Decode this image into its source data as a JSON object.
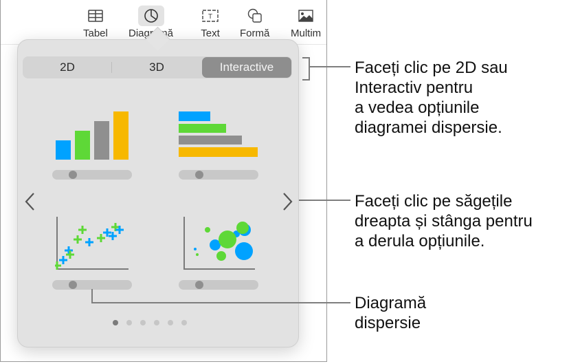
{
  "toolbar": {
    "items": [
      {
        "label": "Tabel",
        "icon": "table-icon"
      },
      {
        "label": "Diagramă",
        "icon": "chart-icon",
        "active": true
      },
      {
        "label": "Text",
        "icon": "text-box-icon"
      },
      {
        "label": "Formă",
        "icon": "shape-icon"
      },
      {
        "label": "Multim",
        "icon": "media-icon"
      }
    ]
  },
  "chart_picker": {
    "tabs": [
      {
        "label": "2D"
      },
      {
        "label": "3D"
      },
      {
        "label": "Interactive",
        "selected": true
      }
    ],
    "thumbnails": [
      {
        "name": "column-chart",
        "slider_position": 0.2
      },
      {
        "name": "bar-chart",
        "slider_position": 0.2
      },
      {
        "name": "scatter-chart",
        "slider_position": 0.2
      },
      {
        "name": "bubble-chart",
        "slider_position": 0.2
      }
    ],
    "colors": {
      "blue": "#00a2ff",
      "green": "#5ed837",
      "gray": "#8f8f8f",
      "yellow": "#f7b800"
    },
    "pagination": {
      "current_page": 1,
      "total_pages": 6
    },
    "prev_arrow": "chevron-left-icon",
    "next_arrow": "chevron-right-icon"
  },
  "callouts": [
    {
      "lines": [
        "Faceți clic pe 2D sau",
        "Interactiv pentru",
        "a vedea opțiunile",
        "diagramei dispersie."
      ]
    },
    {
      "lines": [
        "Faceți clic pe săgețile",
        "dreapta și stânga pentru",
        "a derula opțiunile."
      ]
    },
    {
      "lines": [
        "Diagramă",
        "dispersie"
      ]
    }
  ]
}
